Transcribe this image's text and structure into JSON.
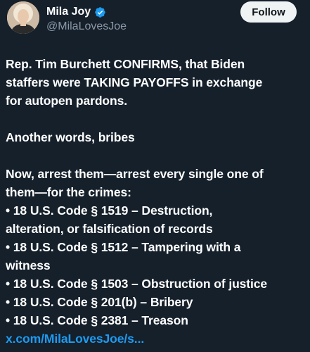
{
  "author": {
    "display_name": "Mila Joy",
    "handle": "@MilaLovesJoe",
    "verified_icon": "verified-badge-icon",
    "avatar": "profile-avatar"
  },
  "actions": {
    "follow_label": "Follow"
  },
  "tweet": {
    "para1_line1": "Rep. Tim Burchett CONFIRMS, that Biden",
    "para1_line2": "staffers were TAKING PAYOFFS in exchange",
    "para1_line3": "for autopen pardons.",
    "para2": "Another words, bribes",
    "para3_line1": "Now, arrest them—arrest every single one of",
    "para3_line2": "them—for the crimes:",
    "bullets": [
      "• 18 U.S. Code § 1519 – Destruction,",
      "alteration, or falsification of records",
      "• 18 U.S. Code § 1512 – Tampering with a",
      "witness",
      "• 18 U.S. Code § 1503 – Obstruction of justice",
      "• 18 U.S. Code § 201(b) – Bribery",
      "• 18 U.S. Code § 2381 – Treason"
    ],
    "link": "x.com/MilaLovesJoe/s..."
  },
  "colors": {
    "background": "#15202b",
    "text": "#ffffff",
    "secondary_text": "#8b98a5",
    "link": "#1d9bf0",
    "verified": "#1d9bf0",
    "button_bg": "#eff3f4"
  }
}
